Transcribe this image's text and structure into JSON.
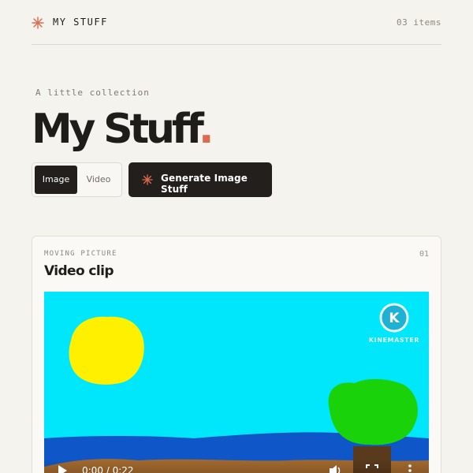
{
  "header": {
    "brand": "MY STUFF",
    "brand_icon": "asterisk-icon",
    "item_count": "03 items"
  },
  "hero": {
    "eyebrow": "A little collection",
    "title": "My Stuff",
    "title_dot": "."
  },
  "toggle": {
    "options": [
      "Image",
      "Video"
    ],
    "selected": "Image"
  },
  "generate_button": {
    "label": "Generate Image Stuff",
    "icon": "asterisk-icon"
  },
  "card": {
    "eyebrow": "MOVING PICTURE",
    "index": "01",
    "title": "Video clip",
    "watermark": "KINEMASTER",
    "player": {
      "time": "0:00 / 0:22",
      "progress": 0
    }
  },
  "colors": {
    "background": "#f5f3ee",
    "accent": "#dd6a4c",
    "dark": "#221f1c",
    "sky": "#00e6fa",
    "sun": "#fff000"
  }
}
